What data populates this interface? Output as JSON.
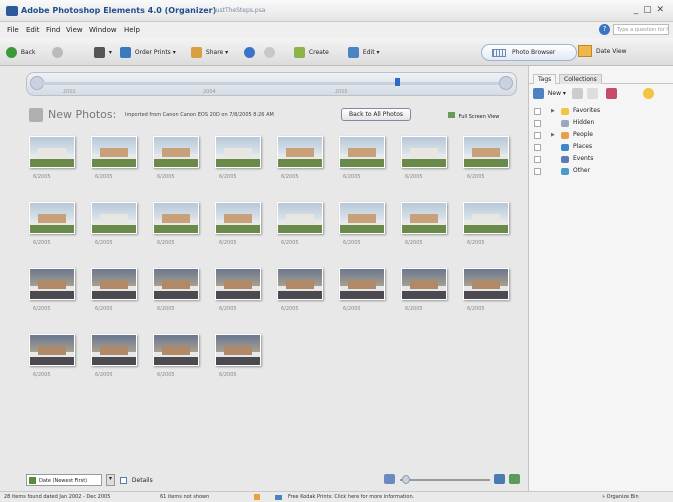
{
  "window": {
    "app_title": "Adobe Photoshop Elements 4.0 (Organizer)",
    "file_name": "justTheSteps.psa",
    "controls": "_ ▢ ✕"
  },
  "menu": [
    "File",
    "Edit",
    "Find",
    "View",
    "Window",
    "Help"
  ],
  "help": {
    "placeholder": "Type a question for help"
  },
  "toolbar": {
    "back": "Back",
    "order_prints": "Order Prints ▾",
    "share": "Share ▾",
    "create": "Create",
    "edit": "Edit ▾",
    "photo_browser": "Photo Browser",
    "date_view": "Date View"
  },
  "timeline": {
    "labels": [
      "2002",
      "2004",
      "2005"
    ]
  },
  "header": {
    "title": "New Photos:",
    "subtitle": "Imported from Canon Canon EOS 20D on 7/8/2005 8:26 AM",
    "back_button": "Back to All Photos",
    "full_screen": "Full Screen View"
  },
  "photos": [
    {
      "date": "6/2005",
      "scene": "house"
    },
    {
      "date": "6/2005",
      "scene": "house"
    },
    {
      "date": "6/2005",
      "scene": "house"
    },
    {
      "date": "6/2005",
      "scene": "house"
    },
    {
      "date": "6/2005",
      "scene": "house"
    },
    {
      "date": "6/2005",
      "scene": "house"
    },
    {
      "date": "6/2005",
      "scene": "house"
    },
    {
      "date": "6/2005",
      "scene": "house"
    },
    {
      "date": "6/2005",
      "scene": "house"
    },
    {
      "date": "6/2005",
      "scene": "house"
    },
    {
      "date": "6/2005",
      "scene": "house"
    },
    {
      "date": "6/2005",
      "scene": "house"
    },
    {
      "date": "6/2005",
      "scene": "house"
    },
    {
      "date": "6/2005",
      "scene": "house"
    },
    {
      "date": "6/2005",
      "scene": "house"
    },
    {
      "date": "6/2005",
      "scene": "house"
    },
    {
      "date": "6/2005",
      "scene": "dusk"
    },
    {
      "date": "6/2005",
      "scene": "dusk"
    },
    {
      "date": "6/2005",
      "scene": "dusk"
    },
    {
      "date": "6/2005",
      "scene": "dusk"
    },
    {
      "date": "6/2005",
      "scene": "dusk"
    },
    {
      "date": "6/2005",
      "scene": "dusk"
    },
    {
      "date": "6/2005",
      "scene": "dusk"
    },
    {
      "date": "6/2005",
      "scene": "dusk"
    },
    {
      "date": "6/2005",
      "scene": "dusk"
    },
    {
      "date": "6/2005",
      "scene": "dusk"
    },
    {
      "date": "6/2005",
      "scene": "dusk"
    },
    {
      "date": "6/2005",
      "scene": "dusk"
    }
  ],
  "bottom": {
    "sort": "Date (Newest First)",
    "details": "Details"
  },
  "status": {
    "found": "28 items found dated Jan 2002 - Dec 2005",
    "not_shown": "61 items not shown",
    "kodak": "Free Kodak Prints: Click here for more information.",
    "organize_bin": "Organize Bin"
  },
  "panel": {
    "tabs": [
      "Tags",
      "Collections"
    ],
    "new_button": "New ▾",
    "tags": [
      {
        "label": "Favorites",
        "icon": "star-icon",
        "color": "#f2c440",
        "expandable": true
      },
      {
        "label": "Hidden",
        "icon": "hidden-icon",
        "color": "#9aa8bc",
        "expandable": false
      },
      {
        "label": "People",
        "icon": "people-icon",
        "color": "#e6a050",
        "expandable": true
      },
      {
        "label": "Places",
        "icon": "globe-icon",
        "color": "#3a88c8",
        "expandable": false
      },
      {
        "label": "Events",
        "icon": "calendar-icon",
        "color": "#5a7ab8",
        "expandable": false
      },
      {
        "label": "Other",
        "icon": "other-icon",
        "color": "#4a9ac8",
        "expandable": false
      }
    ]
  }
}
